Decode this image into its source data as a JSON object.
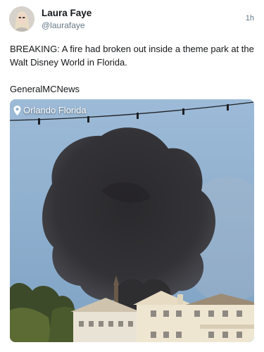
{
  "author": {
    "name": "Laura Faye",
    "handle": "@laurafaye",
    "time": "1h"
  },
  "tweet": {
    "text": "BREAKING: A fire had broken out inside a theme park at the Walt Disney World in Florida.",
    "source": "GeneralMCNews"
  },
  "media": {
    "location": "Orlando Florida",
    "location_icon": "location-pin-icon",
    "smoke_color": "#2c2b2e",
    "sky_color": "#8fb0cf"
  }
}
